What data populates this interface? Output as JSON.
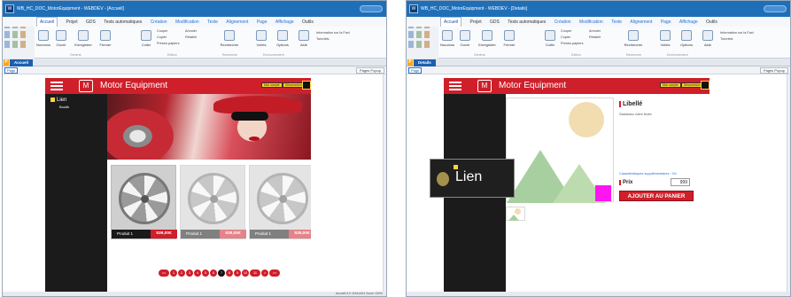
{
  "left_window": {
    "title": "WB_HC_DOC_MotorEquipment - WEBDEV - [Accueil]",
    "menu": [
      "Accueil",
      "Projet",
      "GDS",
      "Tests automatiques",
      "Création",
      "Modification",
      "Texte",
      "Alignement",
      "Page",
      "Affichage",
      "Outils"
    ],
    "ribbon": {
      "buttons": [
        "Nouveau",
        "Ouvrir",
        "Enregistrer",
        "Fermer",
        "Coller",
        "Rechercher",
        "Volets",
        "Options",
        "Aide"
      ],
      "small": [
        "Couper",
        "Copier",
        "Presse-papiers",
        "Annuler",
        "Rétablir",
        "Information sur la Fwd",
        "Tutoriels"
      ],
      "groups": [
        "Général",
        "Edition",
        "Recherche",
        "Environnement"
      ]
    },
    "doc_tab": "Accueil",
    "page_tag": "Page",
    "popup_label": "Pages Popup",
    "status": "Accueil   0,0   115x1404  Zoom 100%"
  },
  "right_window": {
    "title": "WB_HC_DOC_MotorEquipment - WEBDEV - [Details]",
    "menu": [
      "Accueil",
      "Projet",
      "GDS",
      "Tests automatiques",
      "Création",
      "Modification",
      "Texte",
      "Alignement",
      "Page",
      "Affichage",
      "Outils"
    ],
    "ribbon": {
      "buttons": [
        "Nouveau",
        "Ouvrir",
        "Enregistrer",
        "Fermer",
        "Coller",
        "Rechercher",
        "Volets",
        "Options",
        "Aide"
      ],
      "small": [
        "Couper",
        "Copier",
        "Presse-papiers",
        "Annuler",
        "Rétablir",
        "Information sur la Fwd",
        "Tutoriels"
      ],
      "groups": [
        "Général",
        "Edition",
        "Recherche",
        "Environnement"
      ]
    },
    "doc_tab": "Details",
    "page_tag": "Page",
    "popup_label": "Pages Popup"
  },
  "site": {
    "brand": "Motor Equipment",
    "logo": "M",
    "header_buttons": [
      "Mon compte",
      "Déconnexion"
    ],
    "nav_link": "Lien",
    "nav_sub": "Boutik"
  },
  "products": [
    {
      "name": "Produit 1",
      "price": "539,00€"
    },
    {
      "name": "Produit 1",
      "price": "539,00€"
    },
    {
      "name": "Produit 1",
      "price": "539,00€"
    }
  ],
  "pager": [
    "<<",
    "1",
    "2",
    "3",
    "4",
    "5",
    "6",
    "7",
    "8",
    "9",
    "10",
    "11",
    ">",
    ">>"
  ],
  "pager_current": "7",
  "detail": {
    "libelle": "Libellé",
    "saisie": "Saisissez votre texte",
    "carac": "Caractéristiques supplémentaires : %1",
    "prix_label": "Prix",
    "prix_value": "999",
    "add_button": "AJOUTER AU PANIER",
    "lien_label": "Lien"
  },
  "colors": {
    "brand_red": "#cf1f2a",
    "dark": "#1b1b1b",
    "title_blue": "#1f6fb8",
    "accent_yellow": "#ffd43a",
    "magenta": "#ff15f0"
  },
  "icons": [
    "hamburger-menu-icon",
    "logo-icon",
    "cart-icon",
    "wheel-image",
    "car-hero-image",
    "sun-placeholder-icon",
    "mountain-placeholder-icon"
  ]
}
